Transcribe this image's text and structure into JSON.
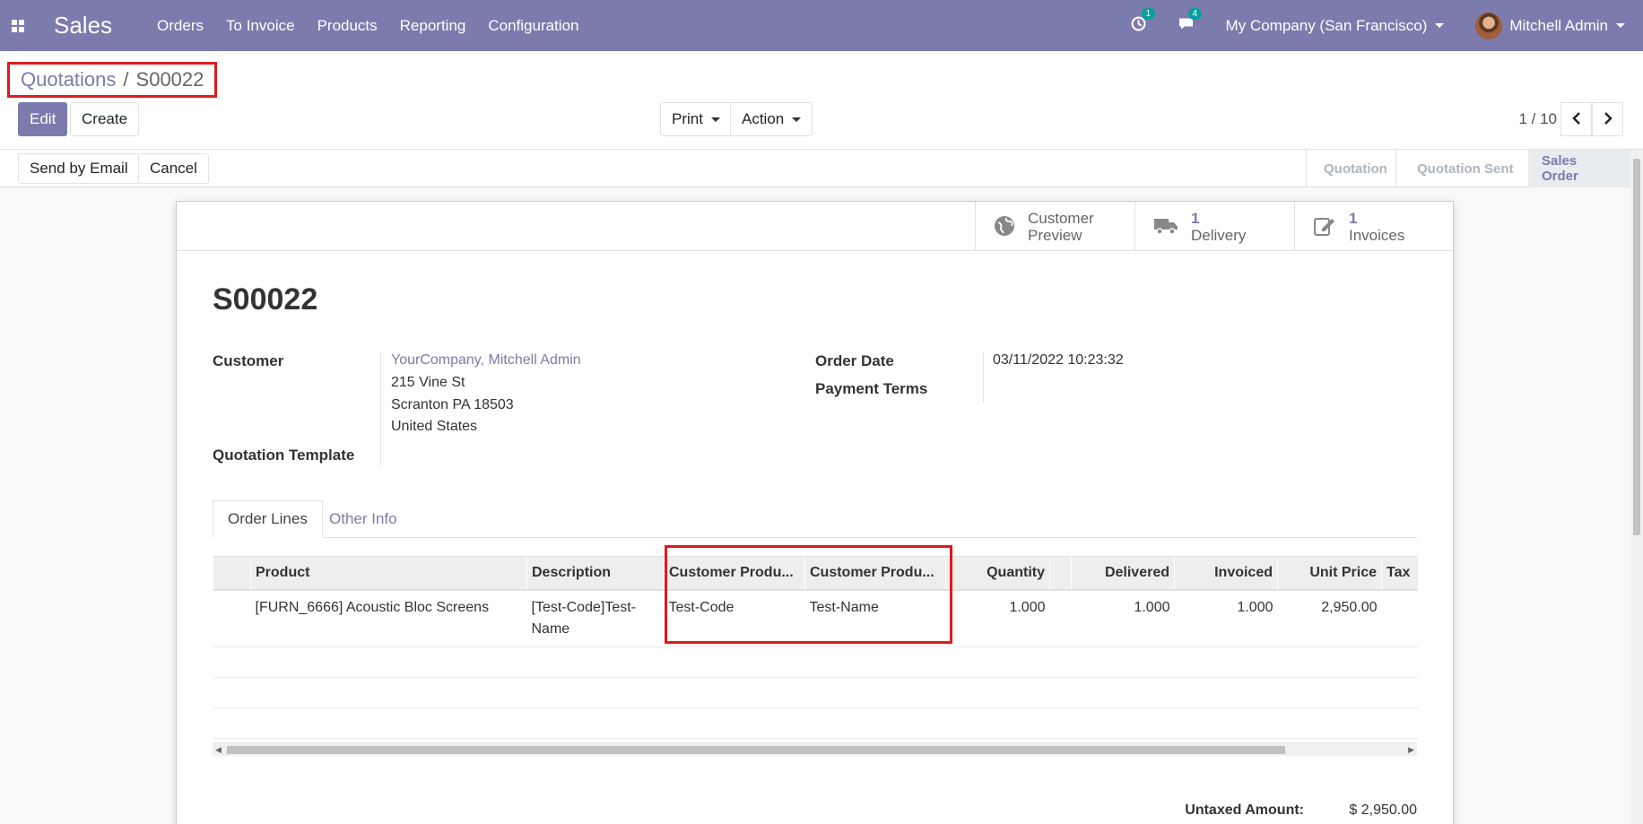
{
  "navbar": {
    "app_title": "Sales",
    "menu": [
      "Orders",
      "To Invoice",
      "Products",
      "Reporting",
      "Configuration"
    ],
    "activity_count": "1",
    "message_count": "4",
    "company": "My Company (San Francisco)",
    "user": "Mitchell Admin"
  },
  "breadcrumb": {
    "parent": "Quotations",
    "sep": "/",
    "current": "S00022"
  },
  "buttons": {
    "edit": "Edit",
    "create": "Create",
    "print": "Print",
    "action": "Action",
    "send_email": "Send by Email",
    "cancel": "Cancel"
  },
  "pager": {
    "value": "1 / 10"
  },
  "statusbar": [
    "Quotation",
    "Quotation Sent",
    "Sales Order"
  ],
  "smart_buttons": {
    "preview": {
      "line1": "Customer",
      "line2": "Preview"
    },
    "delivery": {
      "count": "1",
      "label": "Delivery"
    },
    "invoices": {
      "count": "1",
      "label": "Invoices"
    }
  },
  "record": {
    "name": "S00022",
    "customer_label": "Customer",
    "customer_name": "YourCompany, Mitchell Admin",
    "address": [
      "215 Vine St",
      "Scranton PA 18503",
      "United States"
    ],
    "template_label": "Quotation Template",
    "order_date_label": "Order Date",
    "order_date": "03/11/2022 10:23:32",
    "payment_terms_label": "Payment Terms"
  },
  "tabs": [
    "Order Lines",
    "Other Info"
  ],
  "table": {
    "headers": [
      "Product",
      "Description",
      "Customer Produ...",
      "Customer Produ...",
      "Quantity",
      "Delivered",
      "Invoiced",
      "Unit Price",
      "Tax"
    ],
    "rows": [
      {
        "product": "[FURN_6666] Acoustic Bloc Screens",
        "description": "[Test-Code]Test-Name",
        "cust_code": "Test-Code",
        "cust_name": "Test-Name",
        "quantity": "1.000",
        "delivered": "1.000",
        "invoiced": "1.000",
        "unit_price": "2,950.00"
      }
    ]
  },
  "totals": {
    "untaxed_label": "Untaxed Amount:",
    "untaxed_value": "$ 2,950.00"
  },
  "colors": {
    "brand": "#7c7bad",
    "highlight": "#e01b1b"
  }
}
